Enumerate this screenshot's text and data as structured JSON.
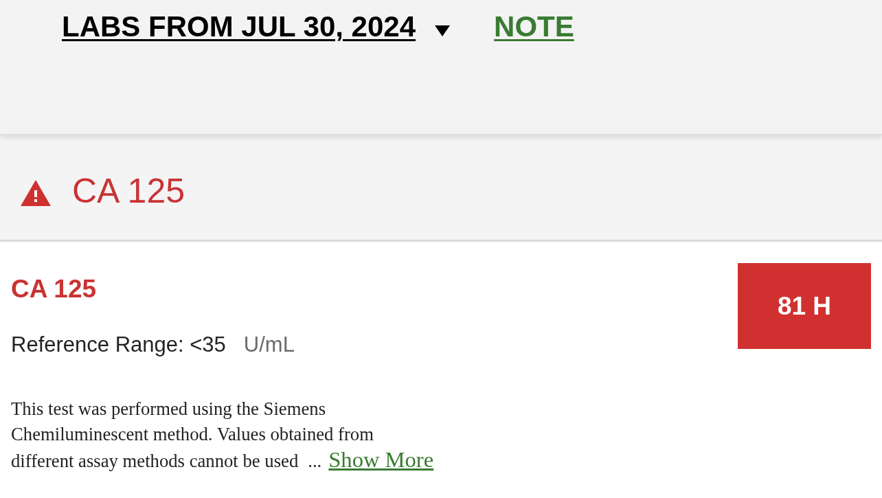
{
  "header": {
    "title": "LABS FROM JUL 30, 2024",
    "note_link": "NOTE"
  },
  "lab": {
    "abnormal": true,
    "section_title": "CA 125",
    "name": "CA 125",
    "reference_range": "Reference Range: <35",
    "unit": "U/mL",
    "result": "81 H",
    "description": "This test was performed using the Siemens Chemiluminescent method. Values obtained from different assay methods cannot be used",
    "ellipsis": "...",
    "show_more": "Show More"
  }
}
